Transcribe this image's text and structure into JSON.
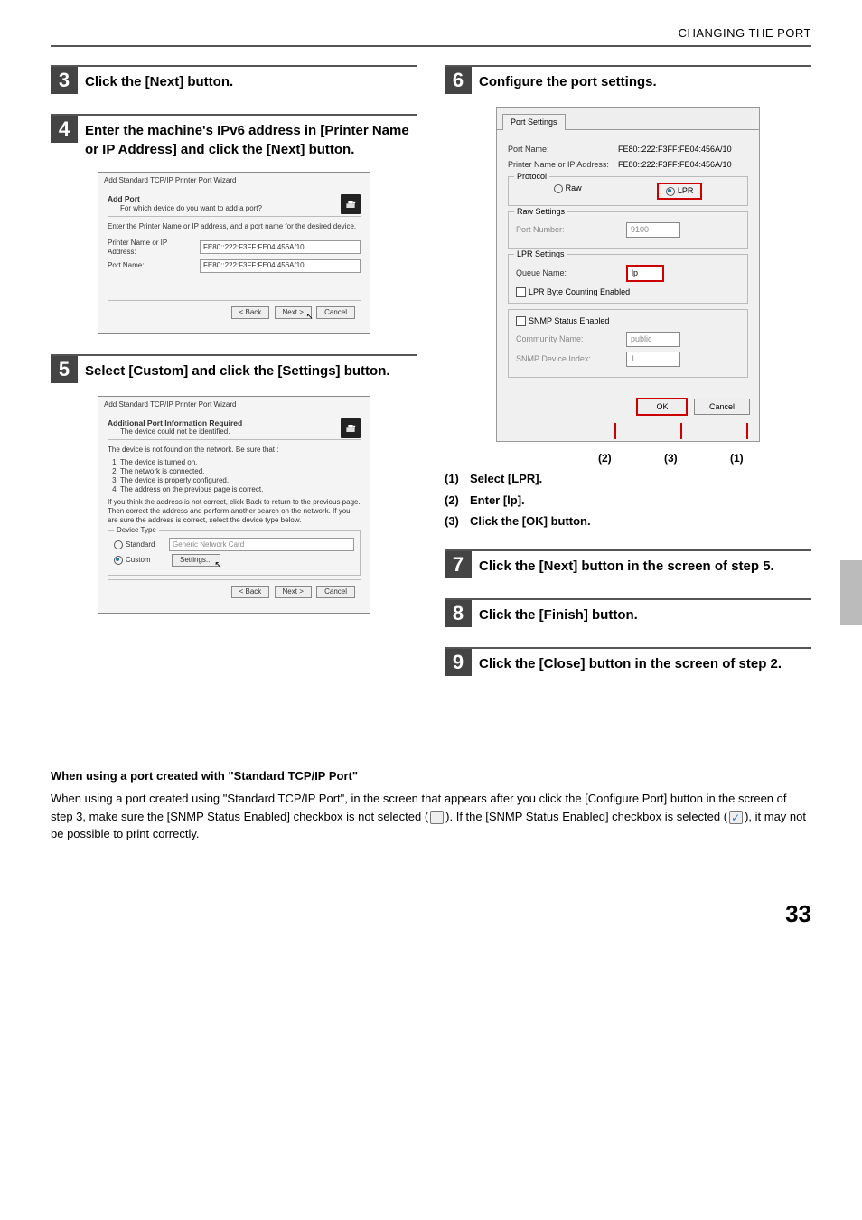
{
  "header": {
    "title": "CHANGING THE PORT"
  },
  "left": {
    "step3": {
      "num": "3",
      "title": "Click the [Next] button."
    },
    "step4": {
      "num": "4",
      "title": "Enter the machine's IPv6 address in [Printer Name or IP Address] and click the [Next] button.",
      "dlg": {
        "wtitle": "Add Standard TCP/IP Printer Port Wizard",
        "h": "Add Port",
        "sub": "For which device do you want to add a port?",
        "instr": "Enter the Printer Name or IP address, and a port name for the desired device.",
        "l1": "Printer Name or IP Address:",
        "v1": "FE80::222:F3FF:FE04:456A/10",
        "l2": "Port Name:",
        "v2": "FE80::222:F3FF:FE04:456A/10",
        "back": "< Back",
        "next": "Next >",
        "cancel": "Cancel"
      }
    },
    "step5": {
      "num": "5",
      "title": "Select [Custom] and click the [Settings] button.",
      "dlg": {
        "wtitle": "Add Standard TCP/IP Printer Port Wizard",
        "h": "Additional Port Information Required",
        "sub": "The device could not be identified.",
        "notfound": "The device is not found on the network.  Be sure that :",
        "li1": "The device is turned on.",
        "li2": "The network is connected.",
        "li3": "The device is properly configured.",
        "li4": "The address on the previous page is correct.",
        "instr2": "If you think the address is not correct, click Back to return to the previous page.  Then correct the address and perform another search on the network.  If you are sure the address is correct, select the device type below.",
        "dt": "Device Type",
        "standard": "Standard",
        "stdval": "Generic Network Card",
        "custom": "Custom",
        "settings": "Settings...",
        "back": "< Back",
        "next": "Next >",
        "cancel": "Cancel"
      }
    }
  },
  "right": {
    "step6": {
      "num": "6",
      "title": "Configure the port settings.",
      "dlg": {
        "tab": "Port Settings",
        "l_portname": "Port Name:",
        "v_portname": "FE80::222:F3FF:FE04:456A/10",
        "l_addr": "Printer Name or IP Address:",
        "v_addr": "FE80::222:F3FF:FE04:456A/10",
        "g_protocol": "Protocol",
        "raw": "Raw",
        "lpr": "LPR",
        "g_raws": "Raw Settings",
        "l_portnum": "Port Number:",
        "v_portnum": "9100",
        "g_lprs": "LPR Settings",
        "l_queue": "Queue Name:",
        "v_queue": "lp",
        "chk_bytec": "LPR Byte Counting Enabled",
        "chk_snmp": "SNMP Status Enabled",
        "l_comm": "Community Name:",
        "v_comm": "public",
        "l_snmpidx": "SNMP Device Index:",
        "v_snmpidx": "1",
        "ok": "OK",
        "cancel": "Cancel"
      },
      "annot": {
        "a1": "(1)",
        "a2": "(2)",
        "a3": "(3)"
      },
      "sub1n": "(1)",
      "sub1": "Select [LPR].",
      "sub2n": "(2)",
      "sub2": "Enter [lp].",
      "sub3n": "(3)",
      "sub3": "Click the [OK] button."
    },
    "step7": {
      "num": "7",
      "title": "Click the [Next] button in the screen of step 5."
    },
    "step8": {
      "num": "8",
      "title": "Click the [Finish] button."
    },
    "step9": {
      "num": "9",
      "title": "Click the [Close] button in the screen of step 2."
    }
  },
  "footnote": {
    "h": "When using a port created with \"Standard TCP/IP Port\"",
    "p1a": "When using a port created using \"Standard TCP/IP Port\", in the screen that appears after you click the [Configure Port] button in the screen of step 3, make sure the [SNMP Status Enabled] checkbox is not selected (",
    "p1b": "). If the [SNMP Status Enabled] checkbox is selected (",
    "p1c": "), it may not be possible to print correctly."
  },
  "pagenum": "33"
}
